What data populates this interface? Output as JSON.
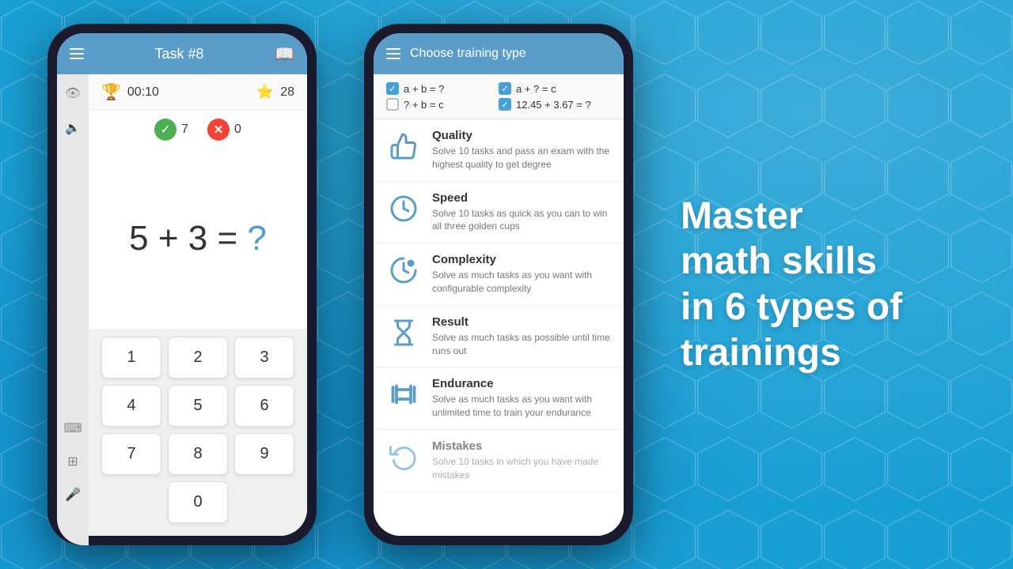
{
  "background": {
    "color": "#1a9fd4"
  },
  "phone1": {
    "header": {
      "title": "Task #8",
      "menu_icon": "hamburger-icon",
      "book_icon": "book-icon"
    },
    "stats": {
      "timer": "00:10",
      "score": "28",
      "correct_count": "7",
      "wrong_count": "0"
    },
    "equation": {
      "left": "5 + 3 =",
      "question_mark": "?"
    },
    "keypad": {
      "keys": [
        "1",
        "2",
        "3",
        "4",
        "5",
        "6",
        "7",
        "8",
        "9",
        "0"
      ]
    },
    "sidebar_icons": [
      "eye-icon",
      "speaker-icon",
      "grid-icon",
      "table-icon",
      "mic-icon"
    ]
  },
  "phone2": {
    "header": {
      "title": "Choose training type",
      "menu_icon": "hamburger-icon"
    },
    "checkboxes": [
      {
        "label": "a + b = ?",
        "checked": true
      },
      {
        "label": "a + ? = c",
        "checked": true
      },
      {
        "label": "? + b = c",
        "checked": false
      },
      {
        "label": "12.45 + 3.67 = ?",
        "checked": true
      }
    ],
    "training_types": [
      {
        "id": "quality",
        "icon": "thumbs-up-icon",
        "title": "Quality",
        "description": "Solve 10 tasks and pass an exam with the highest quality to get degree"
      },
      {
        "id": "speed",
        "icon": "timer-icon",
        "title": "Speed",
        "description": "Solve 10 tasks as quick as you can to win all three golden cups"
      },
      {
        "id": "complexity",
        "icon": "gauge-icon",
        "title": "Complexity",
        "description": "Solve as much tasks as you want with configurable complexity"
      },
      {
        "id": "result",
        "icon": "hourglass-icon",
        "title": "Result",
        "description": "Solve as much tasks as possible until time runs out"
      },
      {
        "id": "endurance",
        "icon": "dumbbell-icon",
        "title": "Endurance",
        "description": "Solve as much tasks as you want with unlimited time to train your endurance"
      },
      {
        "id": "mistakes",
        "icon": "history-icon",
        "title": "Mistakes",
        "description": "Solve 10 tasks in which you have made mistakes"
      }
    ]
  },
  "hero": {
    "line1": "Master",
    "line2": "math skills",
    "line3": "in 6 types of",
    "line4": "trainings"
  }
}
